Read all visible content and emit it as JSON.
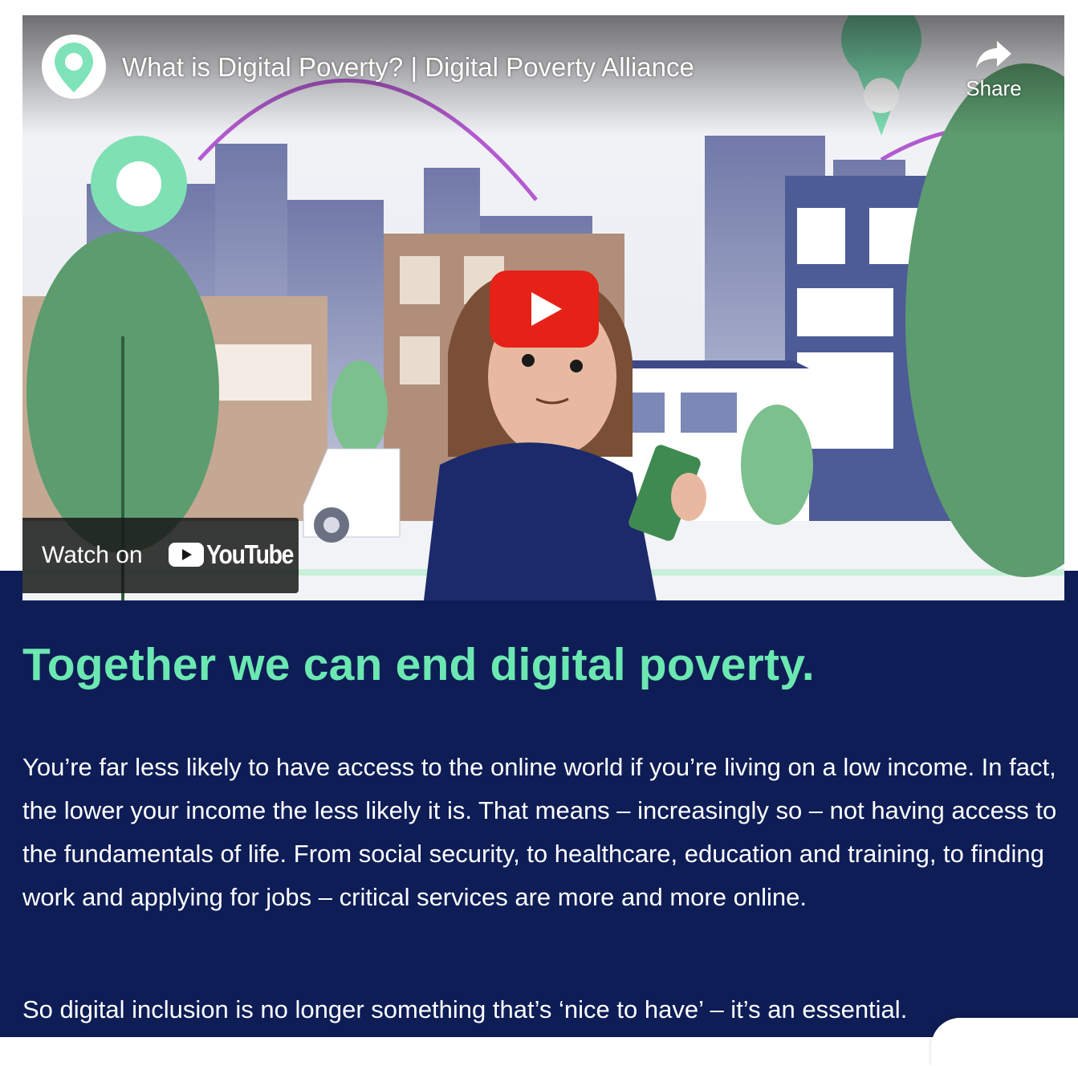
{
  "video": {
    "title": "What is Digital Poverty? | Digital Poverty Alliance",
    "channel_icon": "map-pin-icon",
    "share_label": "Share",
    "watch_on_label": "Watch on",
    "youtube_label": "YouTube"
  },
  "section": {
    "heading": "Together we can end digital poverty.",
    "paragraphs": [
      "You’re far less likely to have access to the online world if you’re living on a low income. In fact, the lower your income the less likely it is. That means – increasingly so – not having access to the fundamentals of life. From social security, to healthcare, education and training, to finding work and applying for jobs – critical services are more and more online.",
      "So digital inclusion is no longer something that’s ‘nice to have’ – it’s an essential."
    ]
  },
  "colors": {
    "navy_background": "#0e1d56",
    "heading_green": "#6be8b1",
    "youtube_red": "#e62117",
    "brand_mint": "#7ee3b8"
  }
}
